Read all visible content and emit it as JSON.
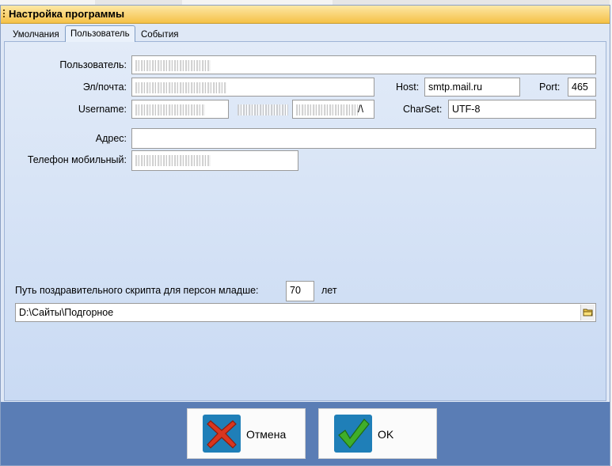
{
  "window": {
    "title": "Настройка программы"
  },
  "tabs": [
    {
      "label": "Умолчания",
      "active": false
    },
    {
      "label": "Пользователь",
      "active": true
    },
    {
      "label": "События",
      "active": false
    }
  ],
  "form": {
    "user_label": "Пользователь:",
    "email_label": "Эл/почта:",
    "username_label": "Username:",
    "host_label": "Host:",
    "host_value": "smtp.mail.ru",
    "port_label": "Port:",
    "port_value": "465",
    "charset_label": "CharSet:",
    "charset_value": "UTF-8",
    "address_label": "Адрес:",
    "address_value": "",
    "phone_label": "Телефон мобильный:",
    "password_suffix": "/\\"
  },
  "script": {
    "age_label": "Путь поздравительного скрипта для персон младше:",
    "age_value": "70",
    "age_unit": "лет",
    "path_value": "D:\\Сайты\\Подгорное"
  },
  "buttons": {
    "cancel_label": "Отмена",
    "ok_label": "OK"
  },
  "icons": {
    "cancel": "red-x-icon",
    "ok": "green-check-icon",
    "browse": "folder-icon"
  },
  "colors": {
    "titlebar": "#f5c148",
    "panel": "#dfe8f6",
    "buttonbar": "#5a7db5",
    "cancel_icon": "#d9361f",
    "ok_icon": "#3fae2a",
    "icon_tile": "#1f7fb8"
  }
}
